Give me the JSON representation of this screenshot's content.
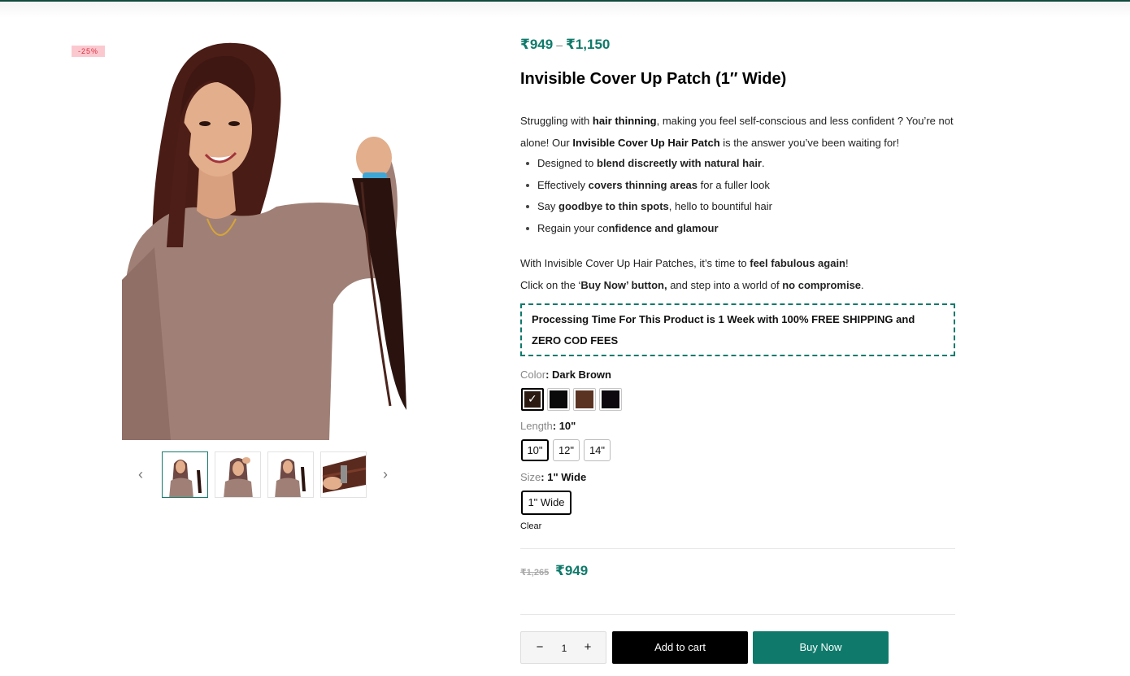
{
  "badge": {
    "discount": "-25%"
  },
  "gallery": {
    "main_image_alt": "Woman holding hair patch",
    "prev_arrow": "‹",
    "next_arrow": "›"
  },
  "product": {
    "price_min": "₹949",
    "price_separator": "–",
    "price_max": "₹1,150",
    "title": "Invisible Cover Up Patch (1″ Wide)",
    "desc_1": "Struggling with ",
    "desc_1b": "hair thinning",
    "desc_2": ", making you feel self-conscious and less confident ? You’re not alone! Our ",
    "desc_2b": "Invisible Cover Up Hair Patch",
    "desc_3": " is the answer you’ve been waiting for!",
    "features": [
      {
        "pre": "Designed to ",
        "bold": "blend discreetly with natural hair",
        "post": "."
      },
      {
        "pre": "Effectively ",
        "bold": "covers thinning areas",
        "post": " for a fuller look"
      },
      {
        "pre": "Say ",
        "bold": "goodbye to thin spots",
        "post": ", hello to bountiful hair"
      },
      {
        "pre": "Regain your co",
        "bold": "nfidence and glamour",
        "post": ""
      }
    ],
    "cta_1a": "With Invisible Cover Up Hair Patches, it’s time to ",
    "cta_1b": "feel fabulous again",
    "cta_1c": "!",
    "cta_2a": "Click on the ‘",
    "cta_2b": "Buy Now’ button,",
    "cta_2c": " and step into a world of ",
    "cta_2d": "no compromise",
    "cta_2e": ".",
    "notice": "Processing Time For This Product is 1 Week with 100% FREE SHIPPING and ZERO COD FEES"
  },
  "options": {
    "color_label": "Color",
    "color_value": ": Dark Brown",
    "colors": [
      {
        "name": "Dark Brown",
        "hex": "#2b1a12"
      },
      {
        "name": "Black",
        "hex": "#0a0a0a"
      },
      {
        "name": "Brown",
        "hex": "#5a3323"
      },
      {
        "name": "Jet Black",
        "hex": "#0d0810"
      }
    ],
    "length_label": "Length",
    "length_value": ": 10\"",
    "lengths": [
      "10\"",
      "12\"",
      "14\""
    ],
    "size_label": "Size",
    "size_value": ": 1\" Wide",
    "sizes": [
      "1\" Wide"
    ],
    "clear": "Clear"
  },
  "purchase": {
    "old_price": "₹1,265",
    "new_price": "₹949",
    "qty": "1",
    "minus": "−",
    "plus": "+",
    "add_to_cart": "Add to cart",
    "buy_now": "Buy Now"
  },
  "colors": {
    "accent": "#0f7a6b",
    "badge_bg": "#fcc8cf"
  }
}
